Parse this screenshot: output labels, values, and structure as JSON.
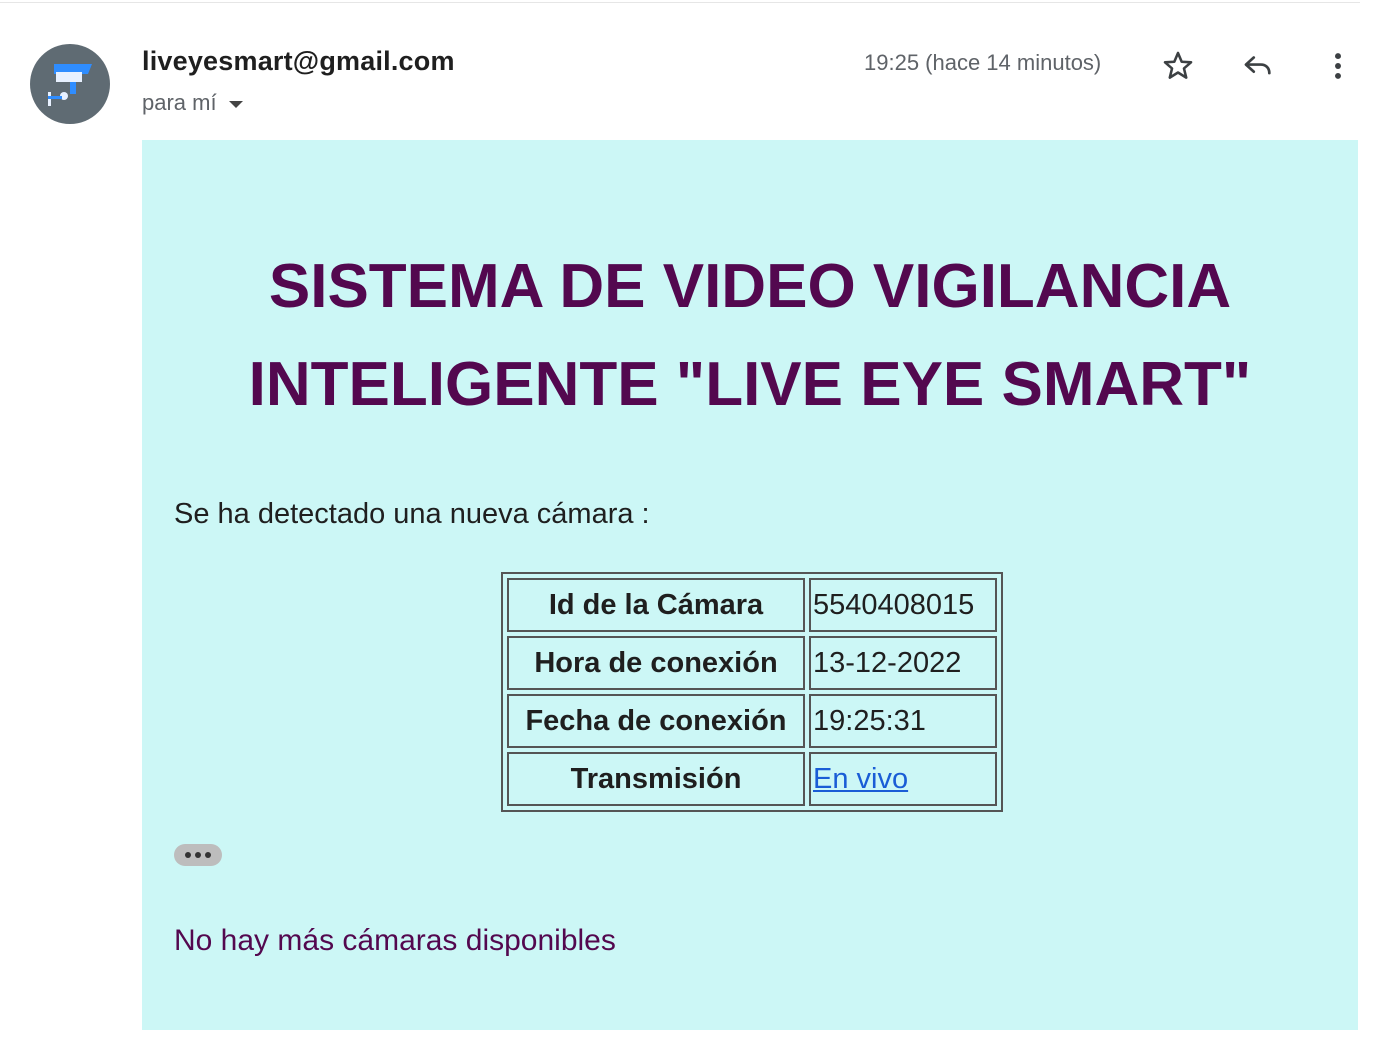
{
  "header": {
    "sender": "liveyesmart@gmail.com",
    "recipient_label": "para mí",
    "timestamp": "19:25 (hace 14 minutos)"
  },
  "icons": {
    "avatar": "security-camera-icon",
    "star": "star-icon",
    "reply": "reply-icon",
    "more": "more-vert-icon",
    "recipient_caret": "caret-down-icon",
    "trimmed_content": "ellipsis-icon"
  },
  "email": {
    "headline_line1": "SISTEMA DE VIDEO VIGILANCIA",
    "headline_line2": "INTELIGENTE \"LIVE EYE SMART\"",
    "intro": "Se ha detectado una nueva cámara :",
    "table": [
      {
        "key": "Id de la Cámara",
        "value": "5540408015"
      },
      {
        "key": "Hora de conexión",
        "value": "13-12-2022"
      },
      {
        "key": "Fecha de conexión",
        "value": "19:25:31"
      },
      {
        "key": "Transmisión",
        "value": "En vivo"
      }
    ],
    "footer": "No hay más cámaras disponibles"
  },
  "colors": {
    "email_background": "#ccf7f6",
    "headline": "#53084f",
    "link": "#1a5dd6",
    "avatar_bg": "#5f6b73"
  }
}
